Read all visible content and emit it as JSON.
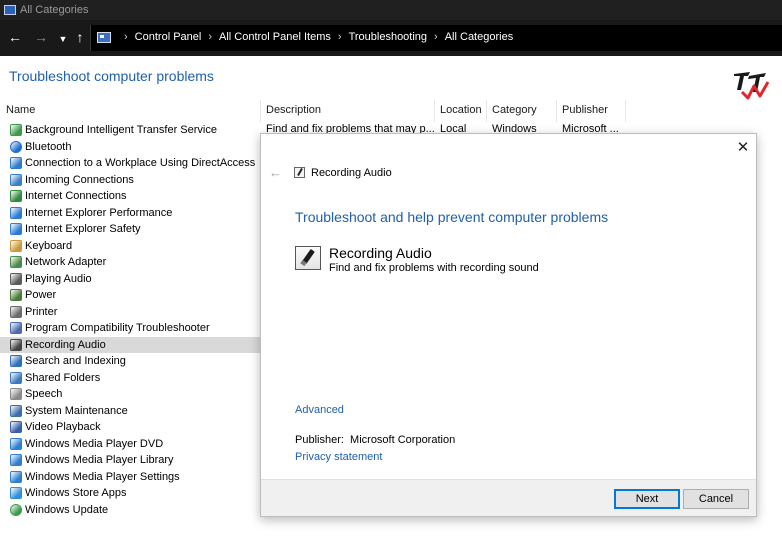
{
  "window": {
    "title": "All Categories"
  },
  "nav": {
    "back_icon": "back-arrow-icon",
    "forward_icon": "forward-arrow-icon",
    "recent_icon": "chevron-down-icon",
    "up_icon": "up-arrow-icon",
    "breadcrumb": [
      "Control Panel",
      "All Control Panel Items",
      "Troubleshooting",
      "All Categories"
    ]
  },
  "page": {
    "title": "Troubleshoot computer problems"
  },
  "columns": {
    "name": "Name",
    "description": "Description",
    "location": "Location",
    "category": "Category",
    "publisher": "Publisher"
  },
  "first_row_details": {
    "description": "Find and fix problems that may p...",
    "location": "Local",
    "category": "Windows",
    "publisher": "Microsoft ..."
  },
  "items": [
    {
      "label": "Background Intelligent Transfer Service",
      "icon": "bits-icon",
      "color": "#3c9a4a"
    },
    {
      "label": "Bluetooth",
      "icon": "bluetooth-icon",
      "color": "#1f6fd0"
    },
    {
      "label": "Connection to a Workplace Using DirectAccess",
      "icon": "directaccess-icon",
      "color": "#2e7bcf"
    },
    {
      "label": "Incoming Connections",
      "icon": "incoming-connections-icon",
      "color": "#3a7fc8"
    },
    {
      "label": "Internet Connections",
      "icon": "internet-connections-icon",
      "color": "#2f8a3c"
    },
    {
      "label": "Internet Explorer Performance",
      "icon": "ie-performance-icon",
      "color": "#2d7bd4"
    },
    {
      "label": "Internet Explorer Safety",
      "icon": "ie-safety-icon",
      "color": "#2d7bd4"
    },
    {
      "label": "Keyboard",
      "icon": "keyboard-icon",
      "color": "#c89a3a"
    },
    {
      "label": "Network Adapter",
      "icon": "network-adapter-icon",
      "color": "#4a8a4a"
    },
    {
      "label": "Playing Audio",
      "icon": "speaker-icon",
      "color": "#5a5a5a"
    },
    {
      "label": "Power",
      "icon": "power-icon",
      "color": "#4a7a3a"
    },
    {
      "label": "Printer",
      "icon": "printer-icon",
      "color": "#6a6a6a"
    },
    {
      "label": "Program Compatibility Troubleshooter",
      "icon": "program-compatibility-icon",
      "color": "#4a6ab0"
    },
    {
      "label": "Recording Audio",
      "icon": "microphone-icon",
      "color": "#444444"
    },
    {
      "label": "Search and Indexing",
      "icon": "search-indexing-icon",
      "color": "#2f6fb5"
    },
    {
      "label": "Shared Folders",
      "icon": "shared-folders-icon",
      "color": "#3c7ac0"
    },
    {
      "label": "Speech",
      "icon": "speech-icon",
      "color": "#8a8a8a"
    },
    {
      "label": "System Maintenance",
      "icon": "system-maintenance-icon",
      "color": "#3c6ea8"
    },
    {
      "label": "Video Playback",
      "icon": "video-playback-icon",
      "color": "#3a5ea8"
    },
    {
      "label": "Windows Media Player DVD",
      "icon": "wmp-dvd-icon",
      "color": "#2e7fd0"
    },
    {
      "label": "Windows Media Player Library",
      "icon": "wmp-library-icon",
      "color": "#2e7fd0"
    },
    {
      "label": "Windows Media Player Settings",
      "icon": "wmp-settings-icon",
      "color": "#2e7fd0"
    },
    {
      "label": "Windows Store Apps",
      "icon": "store-apps-icon",
      "color": "#2f8fd8"
    },
    {
      "label": "Windows Update",
      "icon": "windows-update-icon",
      "color": "#3c9a4a"
    }
  ],
  "selected_index": 13,
  "dialog": {
    "header_title": "Recording Audio",
    "heading": "Troubleshoot and help prevent computer problems",
    "item_name": "Recording Audio",
    "item_desc": "Find and fix problems with recording sound",
    "advanced": "Advanced",
    "publisher_label": "Publisher:",
    "publisher_value": "Microsoft Corporation",
    "privacy": "Privacy statement",
    "next_label": "Next",
    "cancel_label": "Cancel"
  },
  "colors": {
    "link": "#1e5fb0",
    "selected_row": "#d9d9d9",
    "titlebar": "#202020",
    "addressbar": "#000000"
  }
}
